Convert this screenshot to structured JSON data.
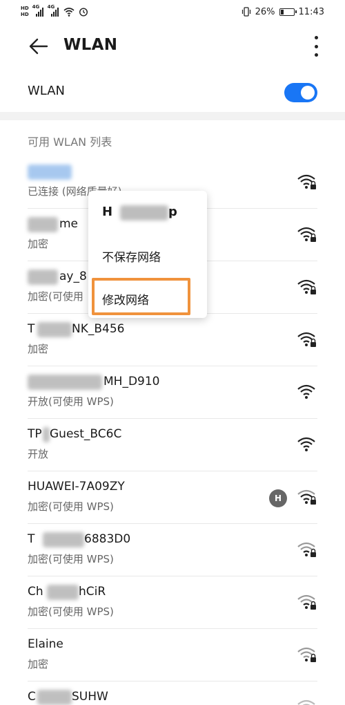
{
  "status_bar": {
    "hd_top": "HD",
    "hd_bottom": "HD",
    "sig1": "4G",
    "sig2": "4G",
    "battery": "26%",
    "time": "11:43"
  },
  "header": {
    "title": "WLAN"
  },
  "wlan_toggle": {
    "label": "WLAN",
    "on": true
  },
  "section_title": "可用 WLAN 列表",
  "networks": [
    {
      "name": "",
      "status": "已连接 (网络质量好)",
      "secured": true
    },
    {
      "name": "me",
      "status": "加密",
      "secured": true
    },
    {
      "name": "ay_8",
      "status": "加密(可使用",
      "secured": true
    },
    {
      "name": "T",
      "name_suffix": "NK_B456",
      "status": "加密",
      "secured": true
    },
    {
      "name": "MH_D910",
      "status": "开放(可使用 WPS)",
      "secured": false
    },
    {
      "name": "TP",
      "name_suffix": "Guest_BC6C",
      "status": "开放",
      "secured": false
    },
    {
      "name": "HUAWEI-7A09ZY",
      "status": "加密(可使用 WPS)",
      "secured": true,
      "badge": "H"
    },
    {
      "name": "T",
      "name_suffix": "6883D0",
      "status": "加密(可使用 WPS)",
      "secured": true
    },
    {
      "name": "Ch",
      "name_suffix": "hCiR",
      "status": "加密(可使用 WPS)",
      "secured": true
    },
    {
      "name": "Elaine",
      "status": "加密",
      "secured": true
    },
    {
      "name": "C",
      "name_suffix": "SUHW",
      "status": "",
      "secured": true
    }
  ],
  "context_menu": {
    "header": "H",
    "header_suffix": "p",
    "items": [
      "不保存网络",
      "修改网络"
    ]
  },
  "colors": {
    "accent": "#1976f5",
    "highlight": "#f0923c"
  }
}
